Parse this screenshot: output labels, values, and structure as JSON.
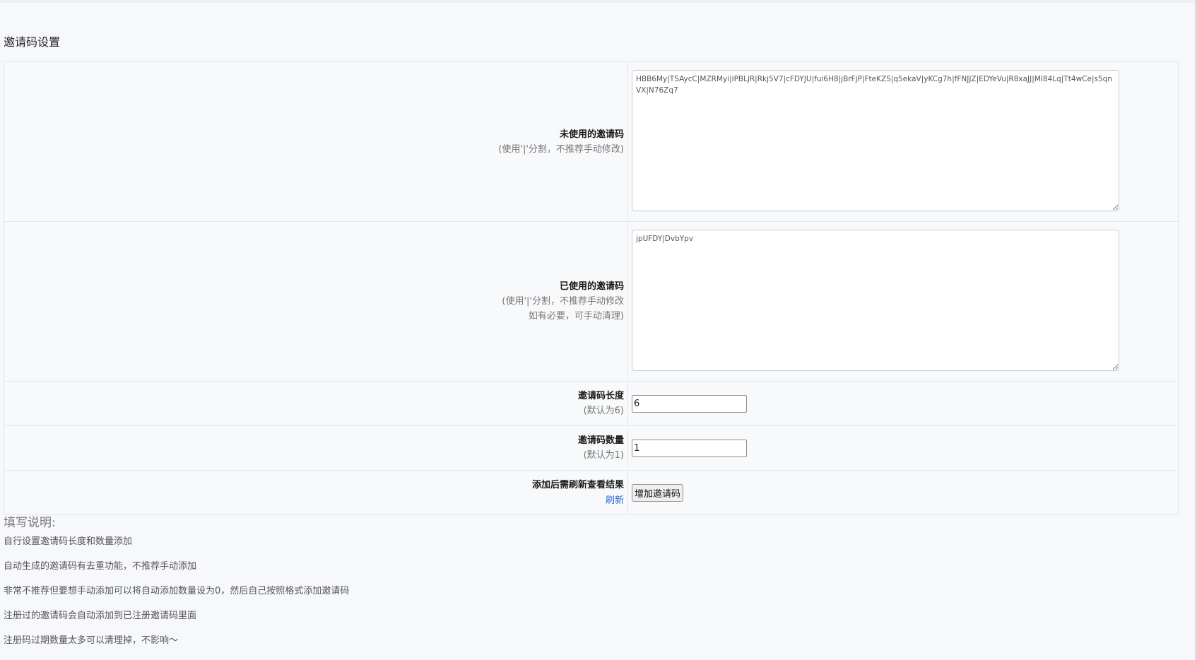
{
  "page": {
    "section_title": "邀请码设置"
  },
  "fields": {
    "unused": {
      "label": "未使用的邀请码",
      "hint": "(使用'|'分割，不推荐手动修改)",
      "value": "HBB6My|TSAycC|MZRMyi|iPBLjR|Rkj5V7|cFDYJU|fui6H8|jBrFjP|FteKZS|q5ekaV|yKCg7h|fFNJJZ|EDYeVu|R8xaJJ|MI84Lq|Tt4wCe|s5qnVX|N76Zq7"
    },
    "used": {
      "label": "已使用的邀请码",
      "hint_line1": "(使用'|'分割，不推荐手动修改",
      "hint_line2": "如有必要，可手动清理)",
      "value": "jpUFDY|DvbYpv"
    },
    "length": {
      "label": "邀请码长度",
      "hint": "(默认为6)",
      "value": "6"
    },
    "count": {
      "label": "邀请码数量",
      "hint": "(默认为1)",
      "value": "1"
    },
    "add": {
      "label": "添加后需刷新查看结果",
      "refresh_link": "刷新",
      "button_label": "增加邀请码"
    }
  },
  "notes": {
    "title": "填写说明:",
    "items": [
      "自行设置邀请码长度和数量添加",
      "自动生成的邀请码有去重功能，不推荐手动添加",
      "非常不推荐但要想手动添加可以将自动添加数量设为0，然后自己按照格式添加邀请码",
      "注册过的邀请码会自动添加到已注册邀请码里面",
      "注册码过期数量太多可以清理掉，不影响～"
    ]
  },
  "colors": {
    "page_background": "#f7f8fb",
    "link": "#2a6ad8",
    "border": "#e3e6ea"
  }
}
